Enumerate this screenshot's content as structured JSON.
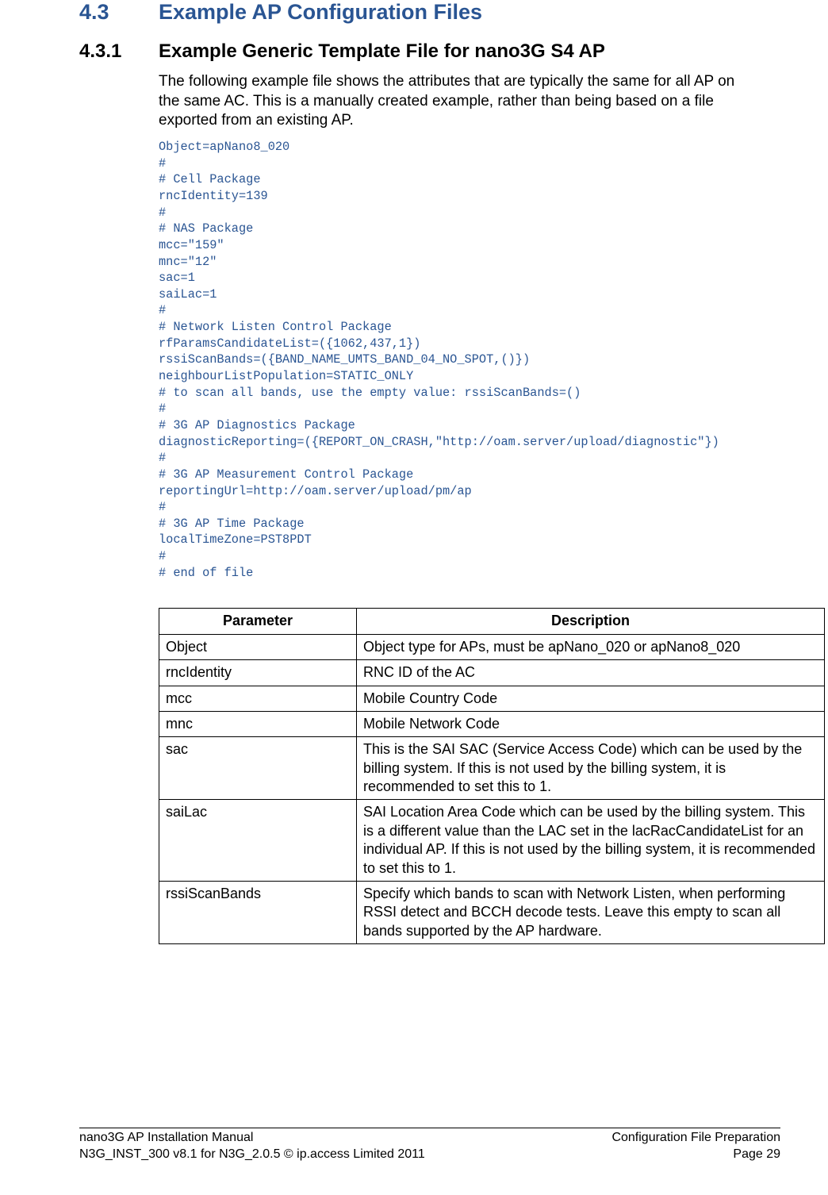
{
  "headings": {
    "h1_num": "4.3",
    "h1_text": "Example AP Configuration Files",
    "h2_num": "4.3.1",
    "h2_text": "Example Generic Template File for nano3G S4 AP"
  },
  "intro": "The following example file shows the attributes that are typically the same for all AP on the same AC. This is a manually created example, rather than being based on a file exported from an existing AP.",
  "code": "Object=apNano8_020\n#\n# Cell Package\nrncIdentity=139\n#\n# NAS Package\nmcc=\"159\"\nmnc=\"12\"\nsac=1\nsaiLac=1\n#\n# Network Listen Control Package\nrfParamsCandidateList=({1062,437,1})\nrssiScanBands=({BAND_NAME_UMTS_BAND_04_NO_SPOT,()})\nneighbourListPopulation=STATIC_ONLY\n# to scan all bands, use the empty value: rssiScanBands=()\n#\n# 3G AP Diagnostics Package\ndiagnosticReporting=({REPORT_ON_CRASH,\"http://oam.server/upload/diagnostic\"})\n#\n# 3G AP Measurement Control Package\nreportingUrl=http://oam.server/upload/pm/ap\n#\n# 3G AP Time Package\nlocalTimeZone=PST8PDT\n#\n# end of file",
  "table": {
    "headers": {
      "col1": "Parameter",
      "col2": "Description"
    },
    "rows": [
      {
        "param": "Object",
        "desc": "Object type for APs, must be apNano_020 or apNano8_020"
      },
      {
        "param": "rncIdentity",
        "desc": "RNC ID of the AC"
      },
      {
        "param": "mcc",
        "desc": "Mobile Country Code"
      },
      {
        "param": "mnc",
        "desc": "Mobile Network Code"
      },
      {
        "param": "sac",
        "desc": "This is the SAI SAC (Service Access Code) which can be used by the billing system. If this is not used by the billing system, it is recommended to set this to 1."
      },
      {
        "param": "saiLac",
        "desc": "SAI Location Area Code which can be used by the billing system. This is a different value than the LAC set in the lacRacCandidateList for an individual AP. If this is not used by the billing system, it is recommended to set this to 1."
      },
      {
        "param": "rssiScanBands",
        "desc": "Specify which bands to scan with Network Listen, when performing RSSI detect and BCCH decode tests. Leave this empty to scan all bands supported by the AP hardware."
      }
    ]
  },
  "footer": {
    "left1": "nano3G AP Installation Manual",
    "left2": "N3G_INST_300 v8.1 for N3G_2.0.5 © ip.access Limited 2011",
    "right1": "Configuration File Preparation",
    "right2": "Page 29"
  }
}
